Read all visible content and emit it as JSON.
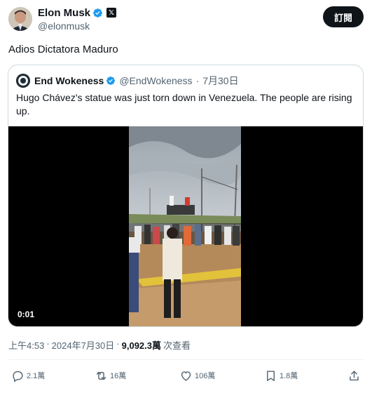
{
  "author": {
    "display_name": "Elon Musk",
    "handle": "@elonmusk",
    "subscribe_label": "訂閱"
  },
  "tweet": {
    "text": "Adios Dictatora Maduro"
  },
  "quote": {
    "display_name": "End Wokeness",
    "handle": "@EndWokeness",
    "separator": "·",
    "date": "7月30日",
    "text": "Hugo Chávez's statue was just torn down in Venezuela. The people are rising up.",
    "video_time": "0:01"
  },
  "meta": {
    "time": "上午4:53",
    "separator": "·",
    "date": "2024年7月30日",
    "views": "9,092.3萬",
    "views_label": "次查看"
  },
  "actions": {
    "replies": "2.1萬",
    "reposts": "16萬",
    "likes": "106萬",
    "bookmarks": "1.8萬"
  },
  "colors": {
    "verified": "#1d9bf0",
    "text_secondary": "#536471"
  }
}
